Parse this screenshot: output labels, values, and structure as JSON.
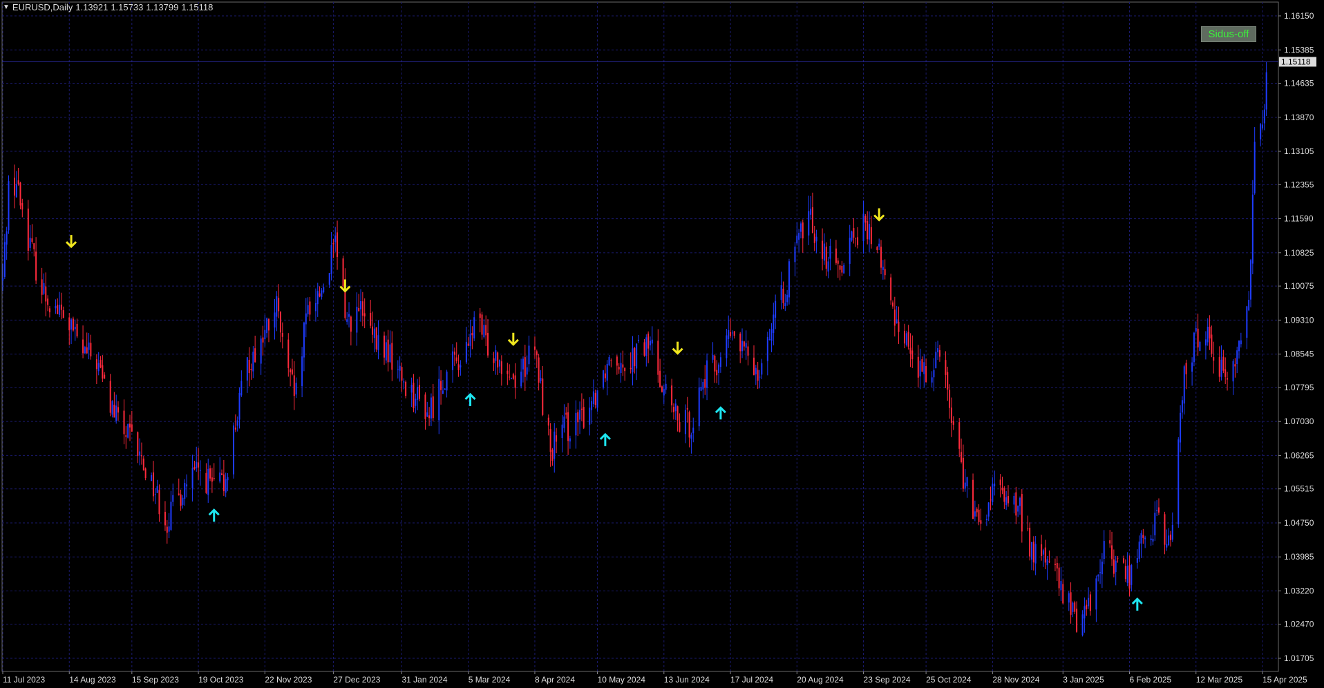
{
  "title": {
    "symbol_timeframe": "EURUSD,Daily",
    "open": "1.13921",
    "high": "1.15733",
    "low": "1.13799",
    "close": "1.15118"
  },
  "sidus_button": {
    "label": "Sidus-off"
  },
  "current_price_label": "1.15118",
  "colors": {
    "background": "#000000",
    "grid": "#1a1a6e",
    "bull_candle": "#1e3cff",
    "bear_candle": "#ff2a3c",
    "buy_arrow": "#1ee6f0",
    "sell_arrow": "#f0e61e",
    "axis_text": "#dcdcdc"
  },
  "chart_data": {
    "type": "candlestick",
    "y_ticks": [
      "1.16150",
      "1.15385",
      "1.14635",
      "1.13870",
      "1.13105",
      "1.12355",
      "1.11590",
      "1.10825",
      "1.10075",
      "1.09310",
      "1.08545",
      "1.07795",
      "1.07030",
      "1.06265",
      "1.05515",
      "1.04750",
      "1.03985",
      "1.03220",
      "1.02470",
      "1.01705"
    ],
    "x_ticks": [
      "11 Jul 2023",
      "14 Aug 2023",
      "15 Sep 2023",
      "19 Oct 2023",
      "22 Nov 2023",
      "27 Dec 2023",
      "31 Jan 2024",
      "5 Mar 2024",
      "8 Apr 2024",
      "10 May 2024",
      "13 Jun 2024",
      "17 Jul 2024",
      "20 Aug 2024",
      "23 Sep 2024",
      "25 Oct 2024",
      "28 Nov 2024",
      "3 Jan 2025",
      "6 Feb 2025",
      "12 Mar 2025",
      "15 Apr 2025"
    ],
    "ylim": [
      1.0133,
      1.166
    ],
    "close_path": [
      [
        "11 Jul 2023",
        1.102
      ],
      [
        "14 Jul 2023",
        1.123
      ],
      [
        "18 Jul 2023",
        1.124
      ],
      [
        "24 Jul 2023",
        1.112
      ],
      [
        "31 Jul 2023",
        1.1
      ],
      [
        "7 Aug 2023",
        1.096
      ],
      [
        "14 Aug 2023",
        1.092
      ],
      [
        "21 Aug 2023",
        1.086
      ],
      [
        "28 Aug 2023",
        1.084
      ],
      [
        "4 Sep 2023",
        1.074
      ],
      [
        "11 Sep 2023",
        1.068
      ],
      [
        "15 Sep 2023",
        1.066
      ],
      [
        "25 Sep 2023",
        1.057
      ],
      [
        "3 Oct 2023",
        1.048
      ],
      [
        "12 Oct 2023",
        1.056
      ],
      [
        "19 Oct 2023",
        1.059
      ],
      [
        "26 Oct 2023",
        1.056
      ],
      [
        "1 Nov 2023",
        1.056
      ],
      [
        "7 Nov 2023",
        1.07
      ],
      [
        "13 Nov 2023",
        1.083
      ],
      [
        "22 Nov 2023",
        1.09
      ],
      [
        "28 Nov 2023",
        1.096
      ],
      [
        "4 Dec 2023",
        1.08
      ],
      [
        "8 Dec 2023",
        1.076
      ],
      [
        "14 Dec 2023",
        1.096
      ],
      [
        "21 Dec 2023",
        1.1
      ],
      [
        "28 Dec 2023",
        1.11
      ],
      [
        "3 Jan 2024",
        1.093
      ],
      [
        "10 Jan 2024",
        1.095
      ],
      [
        "17 Jan 2024",
        1.088
      ],
      [
        "24 Jan 2024",
        1.086
      ],
      [
        "31 Jan 2024",
        1.08
      ],
      [
        "7 Feb 2024",
        1.076
      ],
      [
        "14 Feb 2024",
        1.072
      ],
      [
        "21 Feb 2024",
        1.08
      ],
      [
        "28 Feb 2024",
        1.084
      ],
      [
        "5 Mar 2024",
        1.086
      ],
      [
        "8 Mar 2024",
        1.094
      ],
      [
        "14 Mar 2024",
        1.088
      ],
      [
        "21 Mar 2024",
        1.085
      ],
      [
        "28 Mar 2024",
        1.08
      ],
      [
        "8 Apr 2024",
        1.086
      ],
      [
        "16 Apr 2024",
        1.064
      ],
      [
        "24 Apr 2024",
        1.069
      ],
      [
        "1 May 2024",
        1.07
      ],
      [
        "10 May 2024",
        1.078
      ],
      [
        "17 May 2024",
        1.086
      ],
      [
        "24 May 2024",
        1.084
      ],
      [
        "31 May 2024",
        1.086
      ],
      [
        "6 Jun 2024",
        1.088
      ],
      [
        "13 Jun 2024",
        1.078
      ],
      [
        "20 Jun 2024",
        1.07
      ],
      [
        "27 Jun 2024",
        1.07
      ],
      [
        "3 Jul 2024",
        1.08
      ],
      [
        "10 Jul 2024",
        1.083
      ],
      [
        "17 Jul 2024",
        1.09
      ],
      [
        "24 Jul 2024",
        1.086
      ],
      [
        "31 Jul 2024",
        1.082
      ],
      [
        "7 Aug 2024",
        1.092
      ],
      [
        "14 Aug 2024",
        1.1
      ],
      [
        "20 Aug 2024",
        1.11
      ],
      [
        "26 Aug 2024",
        1.117
      ],
      [
        "3 Sep 2024",
        1.108
      ],
      [
        "10 Sep 2024",
        1.105
      ],
      [
        "17 Sep 2024",
        1.112
      ],
      [
        "23 Sep 2024",
        1.114
      ],
      [
        "30 Sep 2024",
        1.11
      ],
      [
        "7 Oct 2024",
        1.096
      ],
      [
        "14 Oct 2024",
        1.09
      ],
      [
        "21 Oct 2024",
        1.082
      ],
      [
        "25 Oct 2024",
        1.08
      ],
      [
        "1 Nov 2024",
        1.088
      ],
      [
        "7 Nov 2024",
        1.072
      ],
      [
        "14 Nov 2024",
        1.056
      ],
      [
        "21 Nov 2024",
        1.046
      ],
      [
        "28 Nov 2024",
        1.054
      ],
      [
        "5 Dec 2024",
        1.054
      ],
      [
        "12 Dec 2024",
        1.05
      ],
      [
        "19 Dec 2024",
        1.04
      ],
      [
        "27 Dec 2024",
        1.04
      ],
      [
        "3 Jan 2025",
        1.031
      ],
      [
        "10 Jan 2025",
        1.026
      ],
      [
        "17 Jan 2025",
        1.03
      ],
      [
        "24 Jan 2025",
        1.042
      ],
      [
        "31 Jan 2025",
        1.038
      ],
      [
        "6 Feb 2025",
        1.036
      ],
      [
        "13 Feb 2025",
        1.044
      ],
      [
        "20 Feb 2025",
        1.048
      ],
      [
        "27 Feb 2025",
        1.042
      ],
      [
        "5 Mar 2025",
        1.078
      ],
      [
        "12 Mar 2025",
        1.089
      ],
      [
        "19 Mar 2025",
        1.09
      ],
      [
        "26 Mar 2025",
        1.08
      ],
      [
        "2 Apr 2025",
        1.085
      ],
      [
        "8 Apr 2025",
        1.097
      ],
      [
        "11 Apr 2025",
        1.135
      ],
      [
        "15 Apr 2025",
        1.136
      ],
      [
        "17 Apr 2025",
        1.1512
      ]
    ],
    "buy_signals": [
      [
        "27 Oct 2023",
        1.049
      ],
      [
        "6 Mar 2024",
        1.075
      ],
      [
        "14 May 2024",
        1.066
      ],
      [
        "12 Jul 2024",
        1.072
      ],
      [
        "10 Feb 2025",
        1.029
      ]
    ],
    "sell_signals": [
      [
        "15 Aug 2023",
        1.111
      ],
      [
        "2 Jan 2024",
        1.101
      ],
      [
        "28 Mar 2024",
        1.089
      ],
      [
        "20 Jun 2024",
        1.087
      ],
      [
        "1 Oct 2024",
        1.117
      ]
    ],
    "grid": true,
    "current_price": 1.15118
  }
}
